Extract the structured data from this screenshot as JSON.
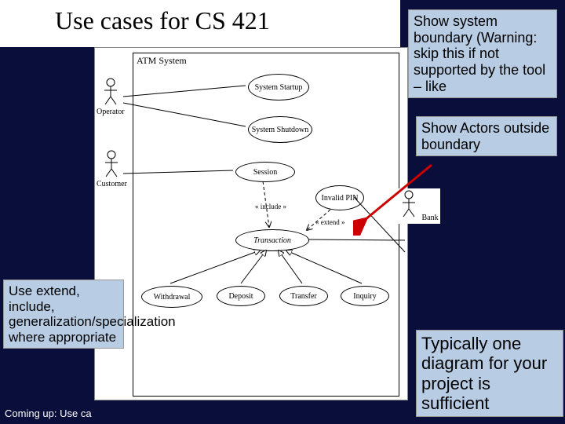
{
  "title": "Use cases for CS 421",
  "system_label": "ATM System",
  "actors": {
    "operator": "Operator",
    "customer": "Customer",
    "bank": "Bank"
  },
  "usecases": {
    "startup": "System Startup",
    "shutdown": "System Shutdown",
    "session": "Session",
    "invalid": "Invalid PIN",
    "transaction": "Transaction",
    "withdraw": "Withdrawal",
    "deposit": "Deposit",
    "transfer": "Transfer",
    "inquiry": "Inquiry"
  },
  "rel": {
    "include": "« include »",
    "extend": "« extend »"
  },
  "notes": {
    "tr": "Show system boundary (Warning: skip this if not supported by the tool – like",
    "tr2": "Show Actors outside boundary",
    "bl": "Use extend, include, generalization/specialization where appropriate",
    "br": "Typically one diagram for your project is sufficient"
  },
  "footer": "Coming up: Use ca"
}
